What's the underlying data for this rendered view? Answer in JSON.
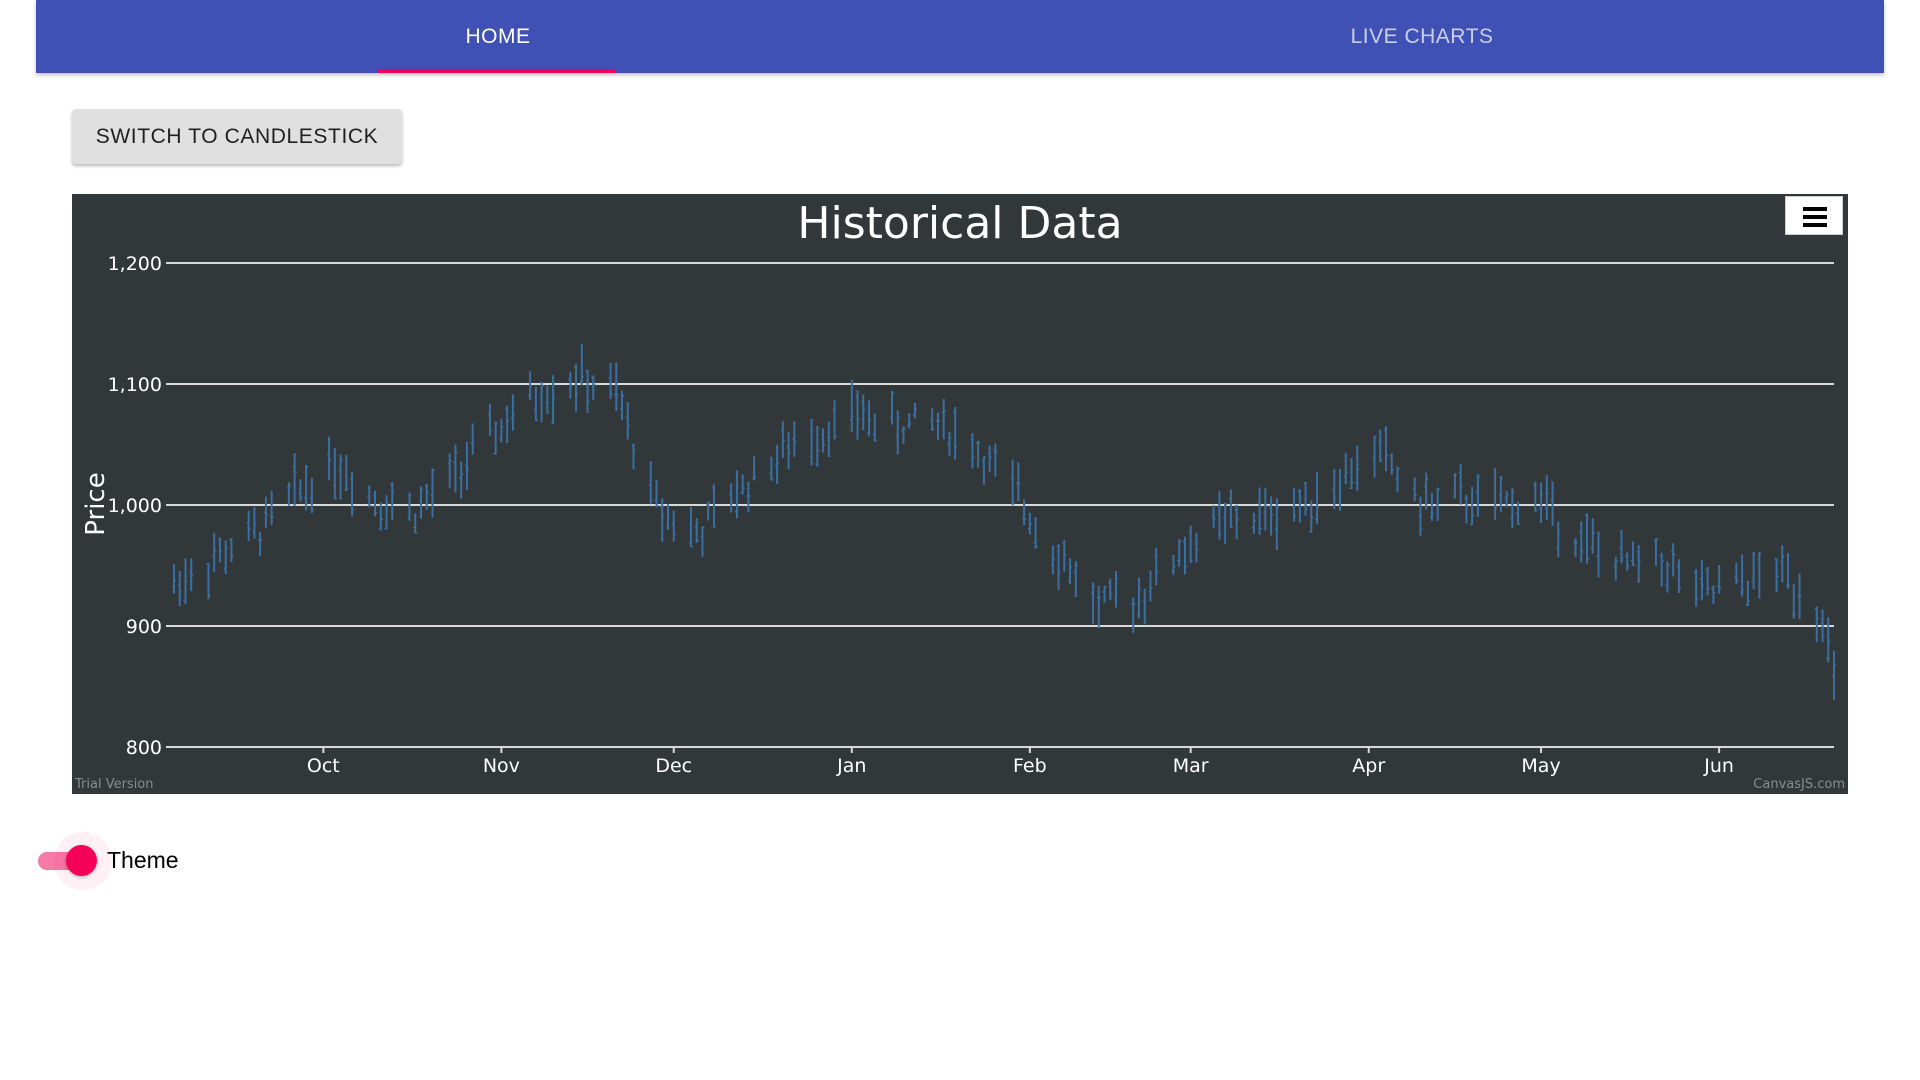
{
  "nav": {
    "tabs": [
      {
        "label": "HOME",
        "active": true
      },
      {
        "label": "LIVE CHARTS",
        "active": false
      }
    ],
    "indicator_color": "#f50057",
    "bar_color": "#3f51b5"
  },
  "toolbar": {
    "switch_label": "SWITCH TO CANDLESTICK"
  },
  "chart_data": {
    "type": "ohlc",
    "title": "Historical Data",
    "ylabel": "Price",
    "xlabel": "",
    "ylim": [
      800,
      1200
    ],
    "yticks": [
      "800",
      "900",
      "1,000",
      "1,100",
      "1,200"
    ],
    "ytick_values": [
      800,
      900,
      1000,
      1100,
      1200
    ],
    "xticks": [
      "Oct",
      "Nov",
      "Dec",
      "Jan",
      "Feb",
      "Mar",
      "Apr",
      "May",
      "Jun"
    ],
    "xtick_dates": [
      "2017-10-01",
      "2017-11-01",
      "2017-12-01",
      "2018-01-01",
      "2018-02-01",
      "2018-03-01",
      "2018-04-01",
      "2018-05-01",
      "2018-06-01"
    ],
    "x_range": [
      "2017-09-05",
      "2018-06-21"
    ],
    "grid": true,
    "background": "#32373a",
    "series_color": "#3b6fa1",
    "watermark_left": "Trial Version",
    "watermark_right": "CanvasJS.com",
    "price_path": [
      [
        "2017-09-05",
        935
      ],
      [
        "2017-09-12",
        955
      ],
      [
        "2017-09-19",
        975
      ],
      [
        "2017-09-26",
        1010
      ],
      [
        "2017-10-03",
        1035
      ],
      [
        "2017-10-10",
        1005
      ],
      [
        "2017-10-17",
        995
      ],
      [
        "2017-10-24",
        1025
      ],
      [
        "2017-10-31",
        1060
      ],
      [
        "2017-11-07",
        1090
      ],
      [
        "2017-11-14",
        1105
      ],
      [
        "2017-11-21",
        1090
      ],
      [
        "2017-11-28",
        1000
      ],
      [
        "2017-12-05",
        975
      ],
      [
        "2017-12-12",
        1010
      ],
      [
        "2017-12-19",
        1040
      ],
      [
        "2017-12-26",
        1060
      ],
      [
        "2018-01-02",
        1075
      ],
      [
        "2018-01-09",
        1065
      ],
      [
        "2018-01-16",
        1070
      ],
      [
        "2018-01-23",
        1045
      ],
      [
        "2018-01-30",
        1005
      ],
      [
        "2018-02-06",
        960
      ],
      [
        "2018-02-13",
        915
      ],
      [
        "2018-02-20",
        925
      ],
      [
        "2018-02-27",
        960
      ],
      [
        "2018-03-06",
        985
      ],
      [
        "2018-03-13",
        990
      ],
      [
        "2018-03-20",
        1000
      ],
      [
        "2018-03-27",
        1020
      ],
      [
        "2018-04-03",
        1045
      ],
      [
        "2018-04-10",
        1000
      ],
      [
        "2018-04-17",
        1005
      ],
      [
        "2018-04-24",
        1000
      ],
      [
        "2018-05-01",
        1005
      ],
      [
        "2018-05-08",
        970
      ],
      [
        "2018-05-15",
        950
      ],
      [
        "2018-05-22",
        955
      ],
      [
        "2018-05-29",
        925
      ],
      [
        "2018-06-05",
        935
      ],
      [
        "2018-06-12",
        945
      ],
      [
        "2018-06-19",
        910
      ],
      [
        "2018-06-21",
        850
      ]
    ]
  },
  "theme": {
    "label": "Theme",
    "on": true,
    "accent": "#f50057"
  }
}
